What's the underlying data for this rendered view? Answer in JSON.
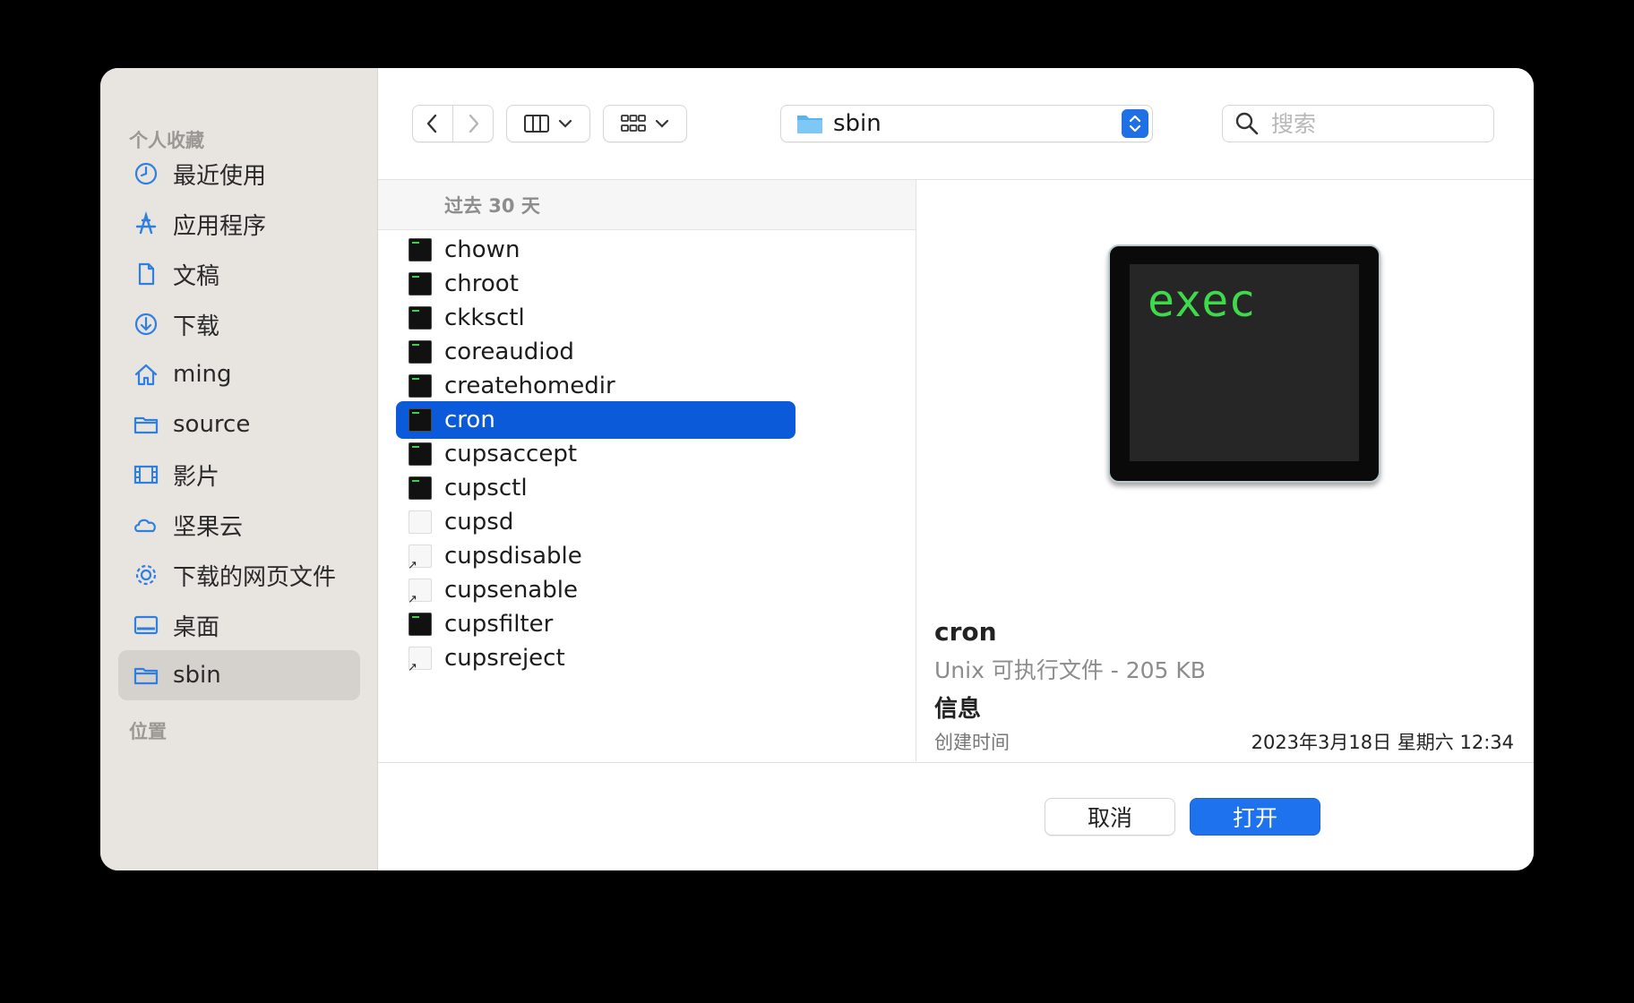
{
  "sidebar": {
    "favorites_heading": "个人收藏",
    "locations_heading": "位置",
    "items": [
      {
        "label": "最近使用",
        "icon": "clock-icon"
      },
      {
        "label": "应用程序",
        "icon": "apps-icon"
      },
      {
        "label": "文稿",
        "icon": "document-icon"
      },
      {
        "label": "下载",
        "icon": "download-icon"
      },
      {
        "label": "ming",
        "icon": "home-icon"
      },
      {
        "label": "source",
        "icon": "folder-icon"
      },
      {
        "label": "影片",
        "icon": "film-icon"
      },
      {
        "label": "坚果云",
        "icon": "cloud-icon"
      },
      {
        "label": "下载的网页文件",
        "icon": "gear-icon"
      },
      {
        "label": "桌面",
        "icon": "desktop-icon"
      },
      {
        "label": "sbin",
        "icon": "folder-icon"
      }
    ],
    "selected": "sbin"
  },
  "toolbar": {
    "path": "sbin",
    "search_placeholder": "搜索"
  },
  "list": {
    "section_header": "过去 30 天",
    "files": [
      {
        "name": "chown",
        "kind": "exec"
      },
      {
        "name": "chroot",
        "kind": "exec"
      },
      {
        "name": "ckksctl",
        "kind": "exec"
      },
      {
        "name": "coreaudiod",
        "kind": "exec"
      },
      {
        "name": "createhomedir",
        "kind": "exec"
      },
      {
        "name": "cron",
        "kind": "exec"
      },
      {
        "name": "cupsaccept",
        "kind": "exec"
      },
      {
        "name": "cupsctl",
        "kind": "exec"
      },
      {
        "name": "cupsd",
        "kind": "doc"
      },
      {
        "name": "cupsdisable",
        "kind": "alias"
      },
      {
        "name": "cupsenable",
        "kind": "alias"
      },
      {
        "name": "cupsfilter",
        "kind": "exec"
      },
      {
        "name": "cupsreject",
        "kind": "alias"
      }
    ],
    "selected": "cron"
  },
  "preview": {
    "icon_text": "exec",
    "name": "cron",
    "kind": "Unix 可执行文件 - 205 KB",
    "info_heading": "信息",
    "created_label": "创建时间",
    "created_value": "2023年3月18日 星期六 12:34"
  },
  "buttons": {
    "cancel": "取消",
    "open": "打开"
  }
}
